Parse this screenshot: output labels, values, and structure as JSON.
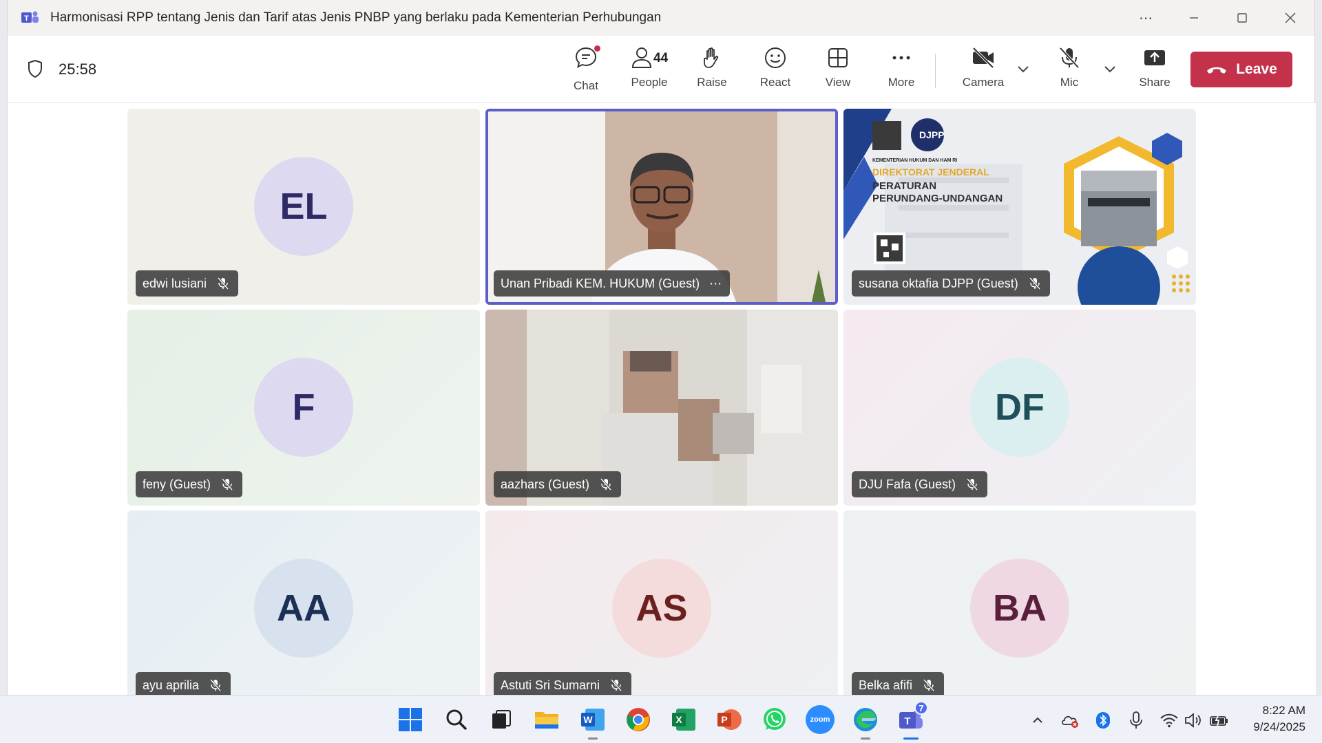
{
  "window": {
    "title": "Harmonisasi RPP tentang Jenis dan Tarif atas Jenis PNBP yang berlaku pada Kementerian Perhubungan"
  },
  "toolbar": {
    "timer": "25:58",
    "chat_label": "Chat",
    "people_label": "People",
    "people_count": "44",
    "raise_label": "Raise",
    "react_label": "React",
    "view_label": "View",
    "more_label": "More",
    "camera_label": "Camera",
    "mic_label": "Mic",
    "share_label": "Share",
    "leave_label": "Leave"
  },
  "participants": [
    {
      "name": "edwi lusiani",
      "initials": "EL",
      "avatar_bg": "#dcd9f0",
      "avatar_fg": "#2e2a66",
      "tile_bg": "#f1efea"
    },
    {
      "name": "Unan Pribadi KEM. HUKUM (Guest)",
      "initials": "",
      "video": true
    },
    {
      "name": "susana oktafia DJPP (Guest)",
      "initials": "",
      "video": true
    },
    {
      "name": "feny (Guest)",
      "initials": "F",
      "avatar_bg": "#dcd9f0",
      "avatar_fg": "#2e2a66",
      "tile_bg": "#eaf2ec"
    },
    {
      "name": "aazhars (Guest)",
      "initials": "",
      "video": true
    },
    {
      "name": "DJU Fafa (Guest)",
      "initials": "DF",
      "avatar_bg": "#dbeef0",
      "avatar_fg": "#1f4f5a",
      "tile_bg": "#f3ecf1"
    },
    {
      "name": "ayu aprilia",
      "initials": "AA",
      "avatar_bg": "#d8e1ee",
      "avatar_fg": "#1c2f55",
      "tile_bg": "#eaf0f4"
    },
    {
      "name": "Astuti Sri Sumarni",
      "initials": "AS",
      "avatar_bg": "#f4dcdc",
      "avatar_fg": "#6b2020",
      "tile_bg": "#f3ecee"
    },
    {
      "name": "Belka afifi",
      "initials": "BA",
      "avatar_bg": "#efd8e4",
      "avatar_fg": "#5a1f3d",
      "tile_bg": "#eef0f3"
    }
  ],
  "slide": {
    "logo_text": "DJPP",
    "line1": "KEMENTERIAN HUKUM DAN HAM RI",
    "line2": "DIREKTORAT JENDERAL",
    "line3": "PERATURAN",
    "line4": "PERUNDANG-UNDANGAN"
  },
  "taskbar": {
    "time": "8:22 AM",
    "date": "9/24/2025",
    "teams_badge": "7",
    "zoom_label": "zoom"
  },
  "colors": {
    "accent": "#5b5fc7",
    "leave": "#c4314b"
  }
}
